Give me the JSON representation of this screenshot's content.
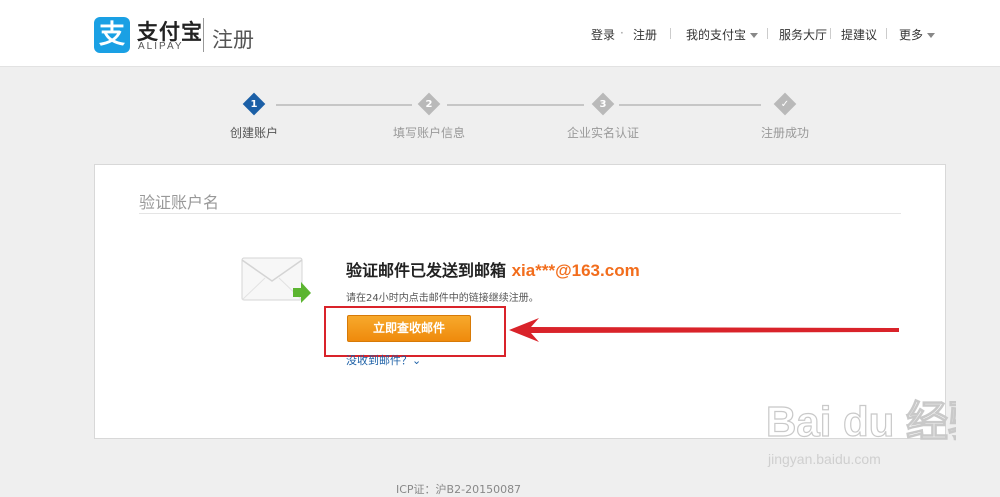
{
  "header": {
    "logo_char": "支",
    "brand_cn": "支付宝",
    "brand_en": "ALIPAY",
    "page_name": "注册",
    "nav": {
      "login": "登录",
      "separator": "·",
      "register": "注册",
      "my_alipay": "我的支付宝",
      "service_hall": "服务大厅",
      "suggest": "提建议",
      "more": "更多"
    }
  },
  "steps": [
    {
      "num": "1",
      "label": "创建账户",
      "active": true
    },
    {
      "num": "2",
      "label": "填写账户信息",
      "active": false
    },
    {
      "num": "3",
      "label": "企业实名认证",
      "active": false
    },
    {
      "num": "✓",
      "label": "注册成功",
      "active": false
    }
  ],
  "panel": {
    "title": "验证账户名",
    "headline": "验证邮件已发送到邮箱",
    "email": "xia***@163.com",
    "hint": "请在24小时内点击邮件中的链接继续注册。",
    "button": "立即查收邮件",
    "no_email": "没收到邮件？"
  },
  "footer": {
    "icp": "ICP证：沪B2-20150087"
  },
  "watermark": {
    "brand": "Bai du 经验",
    "url": "jingyan.baidu.com"
  },
  "colors": {
    "accent": "#f26d1c",
    "brand": "#1aa0e4",
    "annotation": "#d9232a",
    "link": "#1b5fa6"
  }
}
